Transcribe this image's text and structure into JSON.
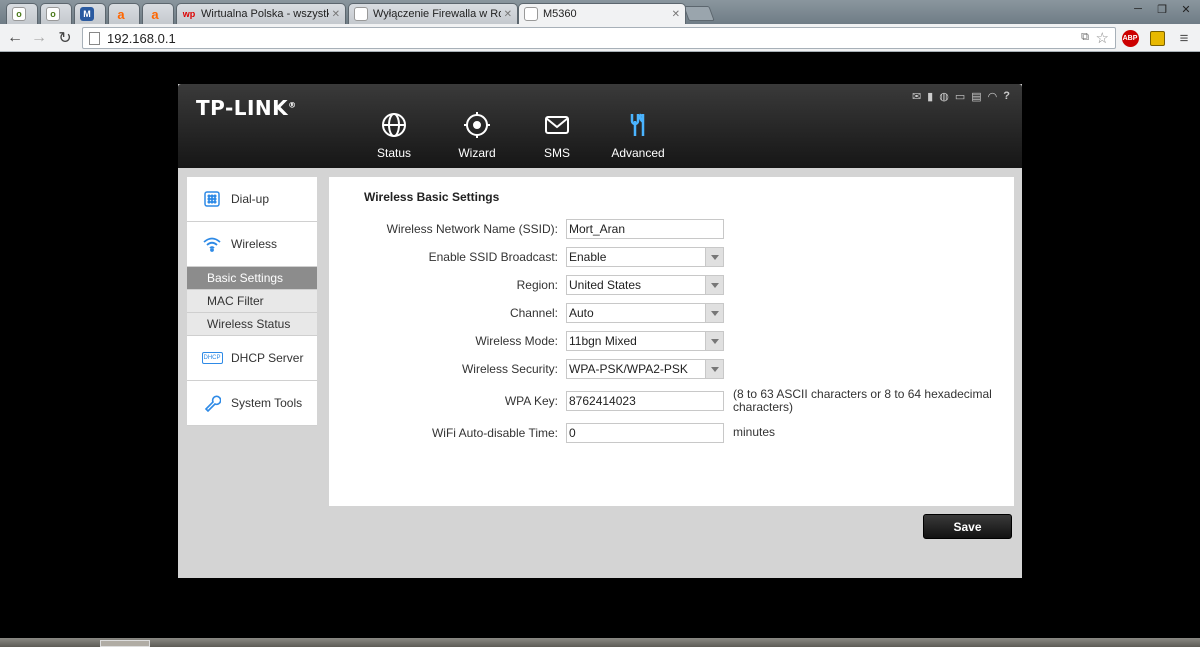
{
  "browser": {
    "tabs": [
      {
        "title": "",
        "favicon": "olx-icon",
        "color": "#5a8a2a",
        "glyph": "olx"
      },
      {
        "title": "",
        "favicon": "olx-icon",
        "color": "#5a8a2a",
        "glyph": "olx"
      },
      {
        "title": "",
        "favicon": "mail-icon",
        "color": "#2a5aa0",
        "glyph": "M"
      },
      {
        "title": "",
        "favicon": "allegro-icon",
        "color": "#f60",
        "glyph": "a"
      },
      {
        "title": "",
        "favicon": "allegro-icon",
        "color": "#f60",
        "glyph": "a"
      },
      {
        "title": "Wirtualna Polska - wszystk",
        "favicon": "wp-icon",
        "color": "#d00",
        "glyph": "wp"
      },
      {
        "title": "Wyłączenie Firewalla w Ro",
        "favicon": "page-icon",
        "color": "#888",
        "glyph": ""
      },
      {
        "title": "M5360",
        "favicon": "page-icon",
        "color": "#888",
        "glyph": ""
      }
    ],
    "url": "192.168.0.1",
    "extensions": {
      "abp": "ABP"
    }
  },
  "router": {
    "logo": "TP-LINK",
    "nav": [
      {
        "label": "Status"
      },
      {
        "label": "Wizard"
      },
      {
        "label": "SMS"
      },
      {
        "label": "Advanced"
      }
    ],
    "sidebar": {
      "dialup": "Dial-up",
      "wireless": "Wireless",
      "sub": [
        "Basic Settings",
        "MAC Filter",
        "Wireless Status"
      ],
      "dhcp": "DHCP Server",
      "dhcp_icon_text": "DHCP",
      "system": "System Tools"
    },
    "form": {
      "title": "Wireless Basic Settings",
      "ssid_label": "Wireless Network Name (SSID):",
      "ssid": "Mort_Aran",
      "broadcast_label": "Enable SSID Broadcast:",
      "broadcast": "Enable",
      "region_label": "Region:",
      "region": "United States",
      "channel_label": "Channel:",
      "channel": "Auto",
      "mode_label": "Wireless Mode:",
      "mode": "11bgn Mixed",
      "security_label": "Wireless Security:",
      "security": "WPA-PSK/WPA2-PSK",
      "key_label": "WPA Key:",
      "key": "8762414023",
      "key_hint": "(8 to 63 ASCII characters or 8 to 64 hexadecimal characters)",
      "autodisable_label": "WiFi Auto-disable Time:",
      "autodisable": "0",
      "autodisable_unit": "minutes"
    },
    "save_label": "Save",
    "accent": "#4ab4ff"
  }
}
